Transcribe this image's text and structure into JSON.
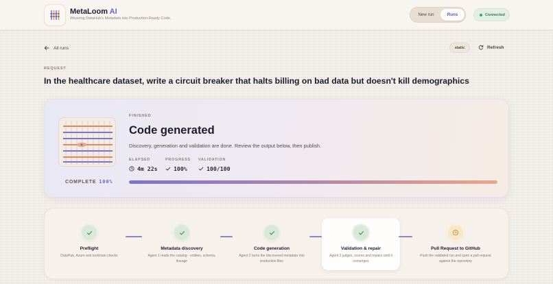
{
  "header": {
    "brand_name": "MetaLoom",
    "brand_accent": "AI",
    "tagline": "Weaving DataHub's Metadata into Production-Ready Code.",
    "nav": {
      "new_run": "New run",
      "runs": "Runs"
    },
    "connection_status": "Connected"
  },
  "toolbar": {
    "back_label": "All runs",
    "mode_chip": "static",
    "refresh_label": "Refresh"
  },
  "request": {
    "label": "REQUEST",
    "text": "In the healthcare dataset, write a circuit breaker that halts billing on bad data but doesn't kill demographics"
  },
  "status": {
    "state": "FINISHED",
    "title": "Code generated",
    "description": "Discovery, generation and validation are done. Review the output below, then publish.",
    "complete_label": "COMPLETE",
    "complete_pct": "100%",
    "progress_fraction": 1.0,
    "stats": {
      "elapsed_label": "ELAPSED",
      "elapsed_value": "4m 22s",
      "progress_label": "PROGRESS",
      "progress_value": "100%",
      "validation_label": "VALIDATION",
      "validation_value": "100/100"
    }
  },
  "pipeline": {
    "steps": [
      {
        "name": "Preflight",
        "desc": "DataHub, Azure and toolchain checks",
        "state": "done"
      },
      {
        "name": "Metadata discovery",
        "desc": "Agent 1 reads the catalog - entities, schema, lineage",
        "state": "done"
      },
      {
        "name": "Code generation",
        "desc": "Agent 2 turns the discovered metadata into production files",
        "state": "done"
      },
      {
        "name": "Validation & repair",
        "desc": "Agent 3 judges, scores and repairs until it converges",
        "state": "done"
      },
      {
        "name": "Pull Request to GitHub",
        "desc": "Push the validated run and open a pull request against the repository",
        "state": "pending"
      }
    ]
  },
  "colors": {
    "accent": "#6b63d8",
    "success": "#3aa366",
    "pending": "#d99a3a"
  }
}
